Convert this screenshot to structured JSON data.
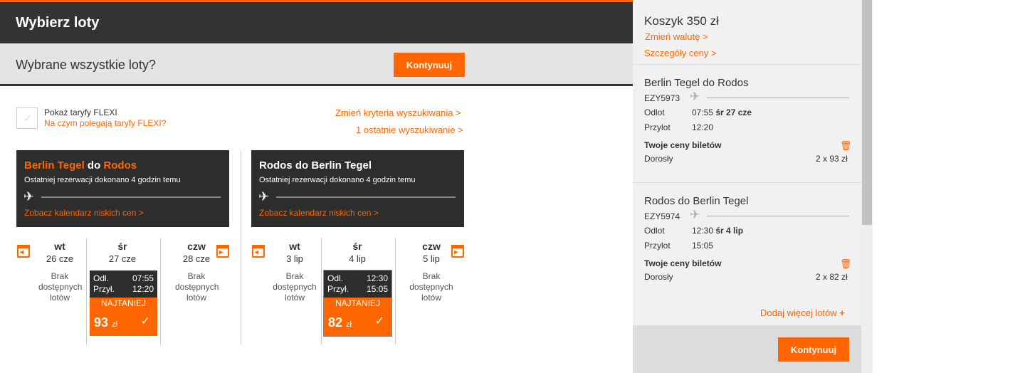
{
  "header": {
    "title": "Wybierz loty"
  },
  "prompt": {
    "question": "Wybrane wszystkie loty?",
    "continue_label": "Kontynuuj"
  },
  "options": {
    "flexi_label": "Pokaż taryfy FLEXI",
    "flexi_info_link": "Na czym polegają taryfy FLEXI?",
    "change_criteria": "Zmień kryteria wyszukiwania >",
    "recent_searches": "1 ostatnie wyszukiwanie >"
  },
  "outbound": {
    "from": "Berlin Tegel",
    "connector": "do",
    "to": "Rodos",
    "last_booking": "Ostatniej rezerwacji dokonano 4 godzin temu",
    "calendar_link": "Zobacz kalendarz niskich cen >",
    "days": [
      {
        "name": "wt",
        "date": "26 cze",
        "none": "Brak dostępnych lotów"
      },
      {
        "name": "śr",
        "date": "27 cze"
      },
      {
        "name": "czw",
        "date": "28 cze",
        "none": "Brak dostępnych lotów"
      }
    ],
    "fare": {
      "dep_label": "Odl.",
      "dep_time": "07:55",
      "arr_label": "Przył.",
      "arr_time": "12:20",
      "badge": "NAJTANIEJ",
      "price": "93",
      "currency": "zł"
    }
  },
  "inbound": {
    "title": "Rodos do Berlin Tegel",
    "last_booking": "Ostatniej rezerwacji dokonano 4 godzin temu",
    "calendar_link": "Zobacz kalendarz niskich cen >",
    "days": [
      {
        "name": "wt",
        "date": "3 lip",
        "none": "Brak dostępnych lotów"
      },
      {
        "name": "śr",
        "date": "4 lip"
      },
      {
        "name": "czw",
        "date": "5 lip",
        "none": "Brak dostępnych lotów"
      }
    ],
    "fare": {
      "dep_label": "Odl.",
      "dep_time": "12:30",
      "arr_label": "Przył.",
      "arr_time": "15:05",
      "badge": "NAJTANIEJ",
      "price": "82",
      "currency": "zł"
    }
  },
  "cart": {
    "title": "Koszyk 350 zł",
    "change_currency": "Zmień walutę >",
    "price_details": "Szczegóły ceny >",
    "flights": [
      {
        "title": "Berlin Tegel do Rodos",
        "flight_no": "EZY5973",
        "dep_label": "Odlot",
        "dep_time": "07:55",
        "dep_date": "śr 27 cze",
        "arr_label": "Przylot",
        "arr_time": "12:20",
        "prices_title": "Twoje ceny biletów",
        "pax_label": "Dorosły",
        "pax_price": "2 x 93 zł"
      },
      {
        "title": "Rodos do Berlin Tegel",
        "flight_no": "EZY5974",
        "dep_label": "Odlot",
        "dep_time": "12:30",
        "dep_date": "śr 4 lip",
        "arr_label": "Przylot",
        "arr_time": "15:05",
        "prices_title": "Twoje ceny biletów",
        "pax_label": "Dorosły",
        "pax_price": "2 x 82 zł"
      }
    ],
    "add_more": "Dodaj więcej lotów",
    "continue_label": "Kontynuuj"
  },
  "icons": [
    "plane-icon",
    "calendar-prev-icon",
    "calendar-next-icon",
    "checkmark-icon",
    "trash-icon",
    "plus-icon"
  ],
  "colors": {
    "accent": "#ff6600",
    "dark": "#2d2d2d",
    "sidebar_bg": "#f1f1f1"
  }
}
